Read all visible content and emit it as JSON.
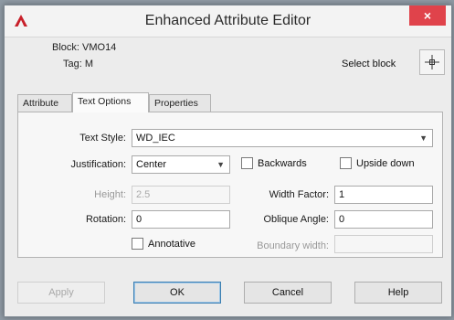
{
  "window": {
    "title": "Enhanced Attribute Editor",
    "close_glyph": "×"
  },
  "header": {
    "block_label": "Block: VMO14",
    "tag_label": "Tag: M",
    "select_block_label": "Select block",
    "select_block_icon": "pick-crosshair-icon"
  },
  "tabs": [
    {
      "label": "Attribute",
      "active": false
    },
    {
      "label": "Text Options",
      "active": true
    },
    {
      "label": "Properties",
      "active": false
    }
  ],
  "form": {
    "text_style_label": "Text Style:",
    "text_style_value": "WD_IEC",
    "justification_label": "Justification:",
    "justification_value": "Center",
    "backwards_label": "Backwards",
    "backwards_checked": false,
    "upside_down_label": "Upside down",
    "upside_down_checked": false,
    "height_label": "Height:",
    "height_value": "2.5",
    "width_factor_label": "Width Factor:",
    "width_factor_value": "1",
    "rotation_label": "Rotation:",
    "rotation_value": "0",
    "oblique_angle_label": "Oblique Angle:",
    "oblique_angle_value": "0",
    "annotative_label": "Annotative",
    "annotative_checked": false,
    "boundary_width_label": "Boundary width:",
    "boundary_width_value": ""
  },
  "buttons": {
    "apply": "Apply",
    "ok": "OK",
    "cancel": "Cancel",
    "help": "Help"
  },
  "colors": {
    "close": "#e0434b",
    "default_button_border": "#3c7fb1",
    "app_icon": "#c8202a"
  }
}
